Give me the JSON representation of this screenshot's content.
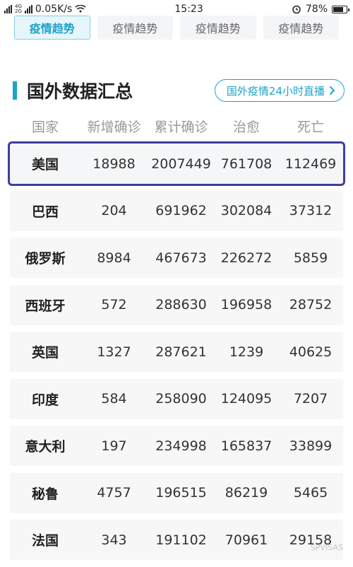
{
  "status_bar": {
    "net_top": "4G",
    "net_bottom": "2G",
    "speed": "0.05K/s",
    "time": "15:23",
    "battery": "78%",
    "battery_level": 0.78
  },
  "tabs": [
    {
      "label": "疫情趋势",
      "active": true
    },
    {
      "label": "疫情趋势",
      "active": false
    },
    {
      "label": "疫情趋势",
      "active": false
    },
    {
      "label": "疫情趋势",
      "active": false
    }
  ],
  "section": {
    "title": "国外数据汇总",
    "live_link": "国外疫情24小时直播"
  },
  "columns": [
    "国家",
    "新增确诊",
    "累计确诊",
    "治愈",
    "死亡"
  ],
  "rows": [
    {
      "country": "美国",
      "new": "18988",
      "total": "2007449",
      "cured": "761708",
      "deaths": "112469",
      "highlighted": true
    },
    {
      "country": "巴西",
      "new": "204",
      "total": "691962",
      "cured": "302084",
      "deaths": "37312"
    },
    {
      "country": "俄罗斯",
      "new": "8984",
      "total": "467673",
      "cured": "226272",
      "deaths": "5859"
    },
    {
      "country": "西班牙",
      "new": "572",
      "total": "288630",
      "cured": "196958",
      "deaths": "28752"
    },
    {
      "country": "英国",
      "new": "1327",
      "total": "287621",
      "cured": "1239",
      "deaths": "40625"
    },
    {
      "country": "印度",
      "new": "584",
      "total": "258090",
      "cured": "124095",
      "deaths": "7207"
    },
    {
      "country": "意大利",
      "new": "197",
      "total": "234998",
      "cured": "165837",
      "deaths": "33899"
    },
    {
      "country": "秘鲁",
      "new": "4757",
      "total": "196515",
      "cured": "86219",
      "deaths": "5465"
    },
    {
      "country": "法国",
      "new": "343",
      "total": "191102",
      "cured": "70961",
      "deaths": "29158"
    }
  ],
  "watermark": "SPVISAS"
}
